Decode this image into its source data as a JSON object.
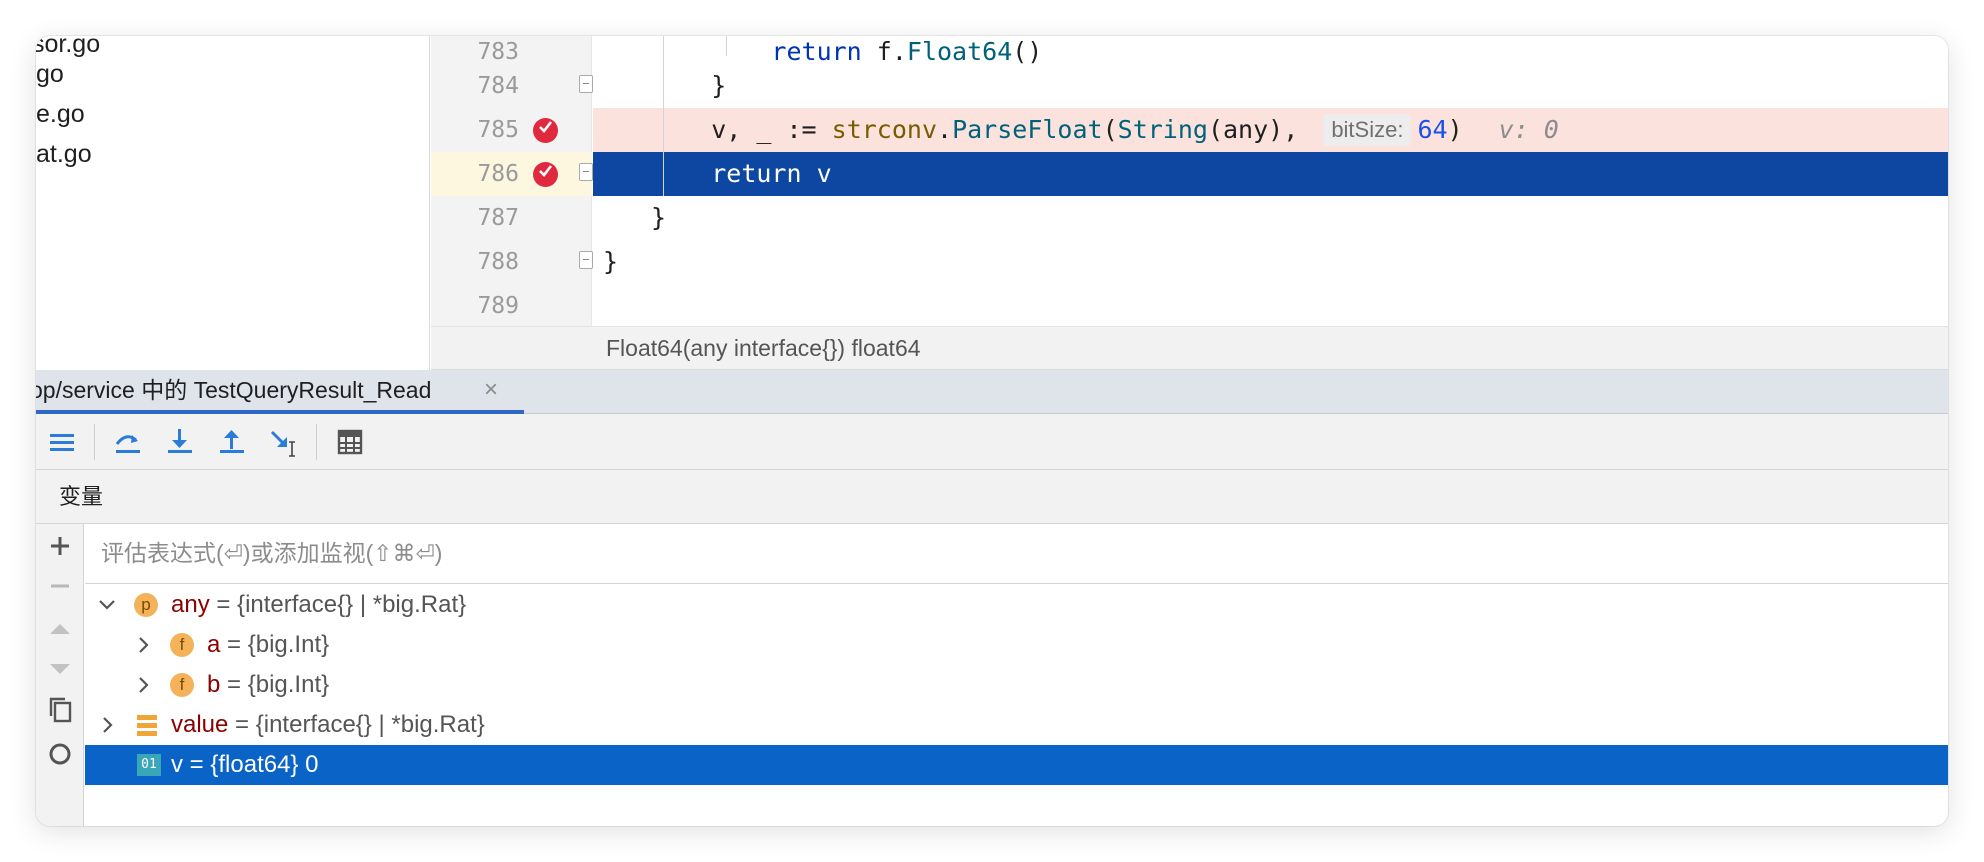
{
  "project_tree": {
    "items": [
      "sor.go",
      "go",
      "e.go",
      "at.go"
    ]
  },
  "editor": {
    "lines": [
      {
        "number": "783",
        "indent": "        ",
        "tokens": [
          {
            "t": "return ",
            "c": "kw"
          },
          {
            "t": "f.",
            "c": ""
          },
          {
            "t": "Float64",
            "c": "fn"
          },
          {
            "t": "()",
            "c": ""
          }
        ]
      },
      {
        "number": "784",
        "indent": "    ",
        "tokens": [
          {
            "t": "}",
            "c": ""
          }
        ]
      },
      {
        "number": "785",
        "indent": "    ",
        "tokens": [
          {
            "t": "v, _ := ",
            "c": ""
          },
          {
            "t": "strconv",
            "c": "pkg"
          },
          {
            "t": ".",
            "c": ""
          },
          {
            "t": "ParseFloat",
            "c": "fn"
          },
          {
            "t": "(",
            "c": ""
          },
          {
            "t": "String",
            "c": "fn"
          },
          {
            "t": "(any), ",
            "c": ""
          }
        ]
      },
      {
        "number": "786",
        "indent": "    ",
        "tokens": [
          {
            "t": "return v",
            "c": ""
          }
        ]
      },
      {
        "number": "787",
        "indent": "",
        "tokens": [
          {
            "t": "}",
            "c": ""
          }
        ]
      },
      {
        "number": "788",
        "indent": "",
        "tokens": [
          {
            "t": "}",
            "c": ""
          }
        ]
      },
      {
        "number": "789",
        "indent": "",
        "tokens": []
      }
    ],
    "param_hint": {
      "name": "bitSize:",
      "value": "64"
    },
    "param_close": ")",
    "inline_value": "v: 0",
    "breakpoint_lines": [
      "785",
      "786"
    ],
    "current_line": "786",
    "breadcrumb": "Float64(any interface{}) float64"
  },
  "debug": {
    "tab_label": "op/service 中的 TestQueryResult_Read",
    "tab_close": "×",
    "toolbar": [
      "frames-layout-icon",
      "step-over-icon",
      "step-into-icon",
      "step-out-icon",
      "run-to-cursor-icon",
      "evaluate-expression-icon"
    ],
    "variables_title": "变量",
    "eval_placeholder": "评估表达式(⏎)或添加监视(⇧⌘⏎)",
    "variables": [
      {
        "expander": "expanded",
        "icon": "p",
        "name": "any",
        "value": " = {interface{} | *big.Rat}",
        "level": 0
      },
      {
        "expander": "collapsed",
        "icon": "f",
        "name": "a",
        "value": " = {big.Int}",
        "level": 1
      },
      {
        "expander": "collapsed",
        "icon": "f",
        "name": "b",
        "value": " = {big.Int}",
        "level": 1
      },
      {
        "expander": "collapsed",
        "icon": "stack",
        "name": "value",
        "value": " = {interface{} | *big.Rat}",
        "level": 0
      },
      {
        "expander": "none",
        "icon": "01",
        "name": "v",
        "value": " = {float64} 0",
        "level": 0,
        "selected": true
      }
    ]
  },
  "colors": {
    "current_line": "#0d47a1",
    "breakpoint_line": "#fbe2dc",
    "breakpoint": "#e0283f",
    "selection": "#0a63c6",
    "tab_underline": "#2f67c4"
  }
}
